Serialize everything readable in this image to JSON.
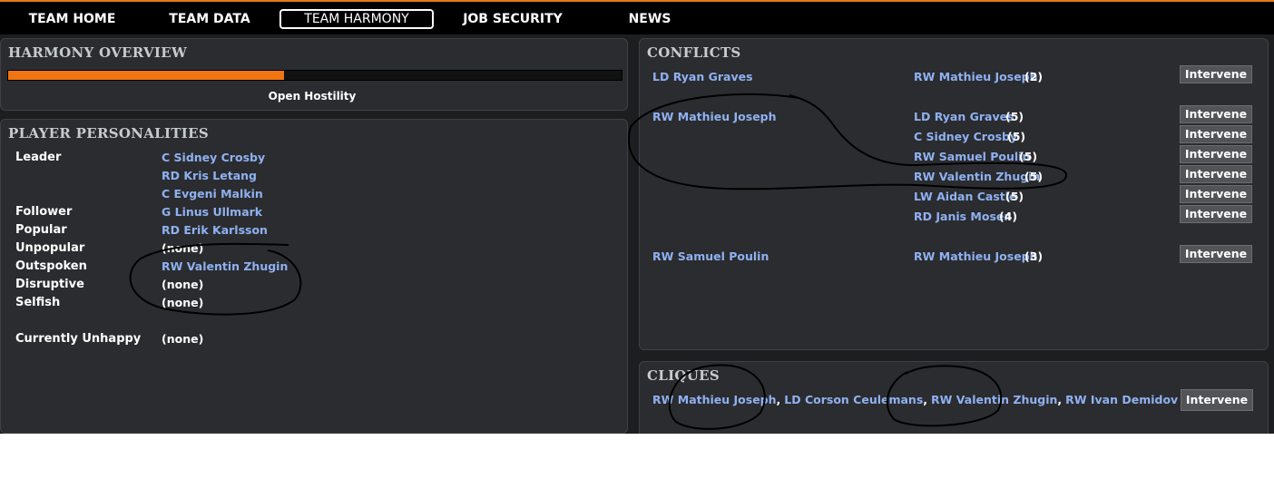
{
  "nav": {
    "tabs": [
      "TEAM HOME",
      "TEAM DATA",
      "TEAM HARMONY",
      "JOB SECURITY",
      "NEWS"
    ],
    "active": "TEAM HARMONY"
  },
  "harmony": {
    "title": "HARMONY OVERVIEW",
    "level": 0.45,
    "status": "Open Hostility"
  },
  "personalities": {
    "title": "PLAYER PERSONALITIES",
    "traits": {
      "leader": "Leader",
      "follower": "Follower",
      "popular": "Popular",
      "unpopular": "Unpopular",
      "outspoken": "Outspoken",
      "disruptive": "Disruptive",
      "selfish": "Selfish",
      "unhappy": "Currently Unhappy"
    },
    "leader_players": [
      "C Sidney Crosby",
      "RD Kris Letang",
      "C Evgeni Malkin"
    ],
    "follower_player": "G Linus Ullmark",
    "popular_player": "RD Erik Karlsson",
    "unpopular_value": "(none)",
    "outspoken_player": "RW Valentin Zhugin",
    "disruptive_value": "(none)",
    "selfish_value": "(none)",
    "unhappy_value": "(none)"
  },
  "conflicts": {
    "title": "CONFLICTS",
    "intervene_label": "Intervene",
    "groups": [
      {
        "player": "LD Ryan Graves",
        "rows": [
          {
            "opponent": "RW Mathieu Joseph",
            "count": "(2)"
          }
        ]
      },
      {
        "player": "RW Mathieu Joseph",
        "rows": [
          {
            "opponent": "LD Ryan Graves",
            "count": "(5)"
          },
          {
            "opponent": "C Sidney Crosby",
            "count": "(5)"
          },
          {
            "opponent": "RW Samuel Poulin",
            "count": "(5)"
          },
          {
            "opponent": "RW Valentin Zhugin",
            "count": "(5)"
          },
          {
            "opponent": "LW Aidan Castle",
            "count": "(5)"
          },
          {
            "opponent": "RD Janis Moser",
            "count": "(4)"
          }
        ]
      },
      {
        "player": "RW Samuel Poulin",
        "rows": [
          {
            "opponent": "RW Mathieu Joseph",
            "count": "(3)"
          }
        ]
      }
    ]
  },
  "cliques": {
    "title": "CLIQUES",
    "members": [
      "RW Mathieu Joseph",
      "LD Corson Ceulemans",
      "RW Valentin Zhugin",
      "RW Ivan Demidov"
    ],
    "separator": ",",
    "intervene_label": "Intervene"
  },
  "colors": {
    "accent": "#ee7512",
    "link": "#8fb1f2",
    "background": "#1d1e20",
    "panel": "#2b2c2f"
  }
}
